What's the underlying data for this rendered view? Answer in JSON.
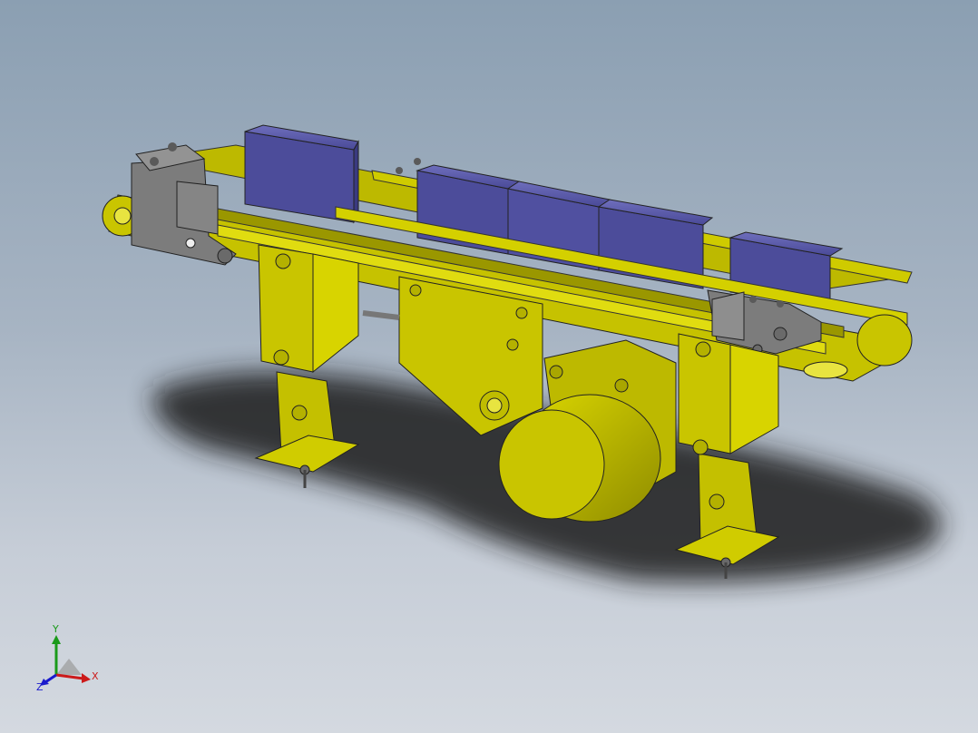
{
  "viewport": {
    "background_top": "#8b9fb2",
    "background_bottom": "#d4d9e0"
  },
  "model": {
    "frame_color": "#c9c500",
    "bracket_color": "#7c7c7c",
    "box_color": "#5050a0",
    "shadow_color": "#1e1e1e"
  },
  "triad": {
    "x_label": "X",
    "y_label": "Y",
    "z_label": "Z",
    "x_color": "#cc1a1a",
    "y_color": "#1a9a1a",
    "z_color": "#1a1acc"
  }
}
